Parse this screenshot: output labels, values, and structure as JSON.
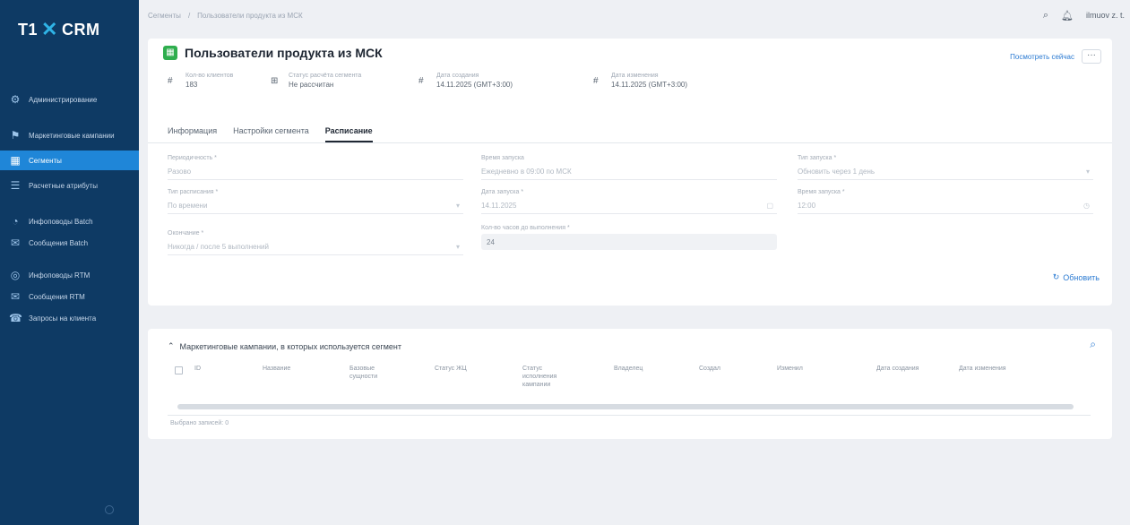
{
  "sidebar": {
    "logo_t1": "T1",
    "logo_x": "✕",
    "logo_crm": "CRM",
    "items": [
      {
        "label": "Администрирование",
        "icon": "admin-icon"
      },
      {
        "label": "Маркетинговые кампании",
        "icon": "flag-icon"
      },
      {
        "label": "Сегменты",
        "icon": "segments-icon",
        "active": true
      },
      {
        "label": "Расчетные атрибуты",
        "icon": "attributes-icon"
      },
      {
        "label": "Инфоповоды Batch",
        "icon": "infopovod-icon"
      },
      {
        "label": "Сообщения Batch",
        "icon": "message-icon"
      },
      {
        "label": "Инфоповоды RTM",
        "icon": "infopovod-rtm-icon"
      },
      {
        "label": "Сообщения RTM",
        "icon": "message-rtm-icon"
      },
      {
        "label": "Запросы на клиента",
        "icon": "phone-icon"
      }
    ]
  },
  "topbar": {
    "crumbs": [
      "Сегменты",
      "/",
      "Пользователи продукта из МСК"
    ],
    "user": "ilmuov z. t."
  },
  "header": {
    "title": "Пользователи продукта из МСК",
    "show_link": "Посмотреть сейчас",
    "more": "···",
    "meta": [
      {
        "label": "Кол-во клиентов",
        "value": "183"
      },
      {
        "label": "Статус расчёта сегмента",
        "value": "Не рассчитан"
      },
      {
        "label": "Дата создания",
        "value": "14.11.2025 (GMT+3:00)"
      },
      {
        "label": "Дата изменения",
        "value": "14.11.2025 (GMT+3:00)"
      }
    ]
  },
  "tabs": [
    "Информация",
    "Настройки сегмента",
    "Расписание"
  ],
  "form": {
    "f1_label": "Периодичность *",
    "f1_value": "Разово",
    "f2_label": "Время запуска",
    "f2_value": "Ежедневно в 09:00 по МСК",
    "f3_label": "Тип запуска *",
    "f3_value": "Обновить через 1 день",
    "f4_label": "Тип расписания *",
    "f4_value": "По времени",
    "f5_label": "Дата запуска *",
    "f5_value": "14.11.2025",
    "f6_label": "Время запуска *",
    "f6_value": "12:00",
    "f7_label": "Окончание *",
    "f7_value": "Никогда / после 5 выполнений",
    "f8_label": "Кол-во часов до выполнения *",
    "f8_value": "24",
    "refresh": "Обновить"
  },
  "campaigns": {
    "title": "Маркетинговые кампании, в которых используется сегмент",
    "columns": [
      "ID",
      "Название",
      "Базовые сущности",
      "Статус ЖЦ",
      "Статус исполнения кампании",
      "Владелец",
      "Создал",
      "Изменил",
      "Дата создания",
      "Дата изменения"
    ],
    "selected": "Выбрано записей: 0"
  }
}
